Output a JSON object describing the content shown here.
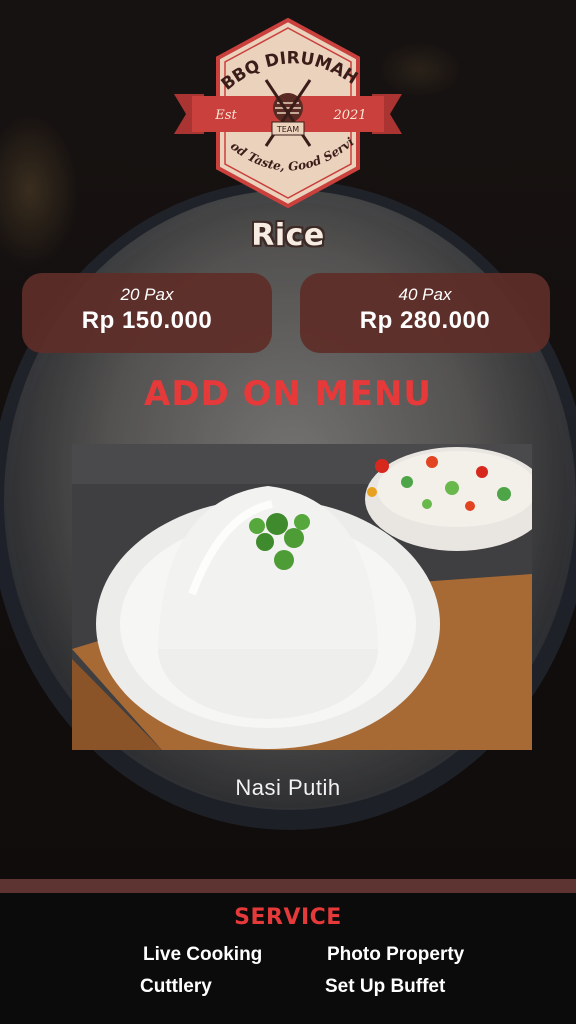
{
  "logo": {
    "name": "BBQ DIRUMAH",
    "est_label": "Est",
    "year": "2021",
    "badge": "TEAM",
    "tagline": "Good Taste, Good Service"
  },
  "title": "Rice",
  "prices": [
    {
      "pax": "20 Pax",
      "price": "Rp 150.000"
    },
    {
      "pax": "40 Pax",
      "price": "Rp 280.000"
    }
  ],
  "addon_title": "ADD ON MENU",
  "dish": {
    "name": "Nasi Putih"
  },
  "service": {
    "title": "SERVICE",
    "items": [
      "Live Cooking",
      "Photo Property",
      "Cuttlery",
      "Set Up Buffet"
    ]
  },
  "colors": {
    "accent_red": "#e5393a",
    "card_brown": "#5f2d28",
    "logo_ribbon": "#c9403d",
    "logo_plate": "#ead2bd"
  }
}
